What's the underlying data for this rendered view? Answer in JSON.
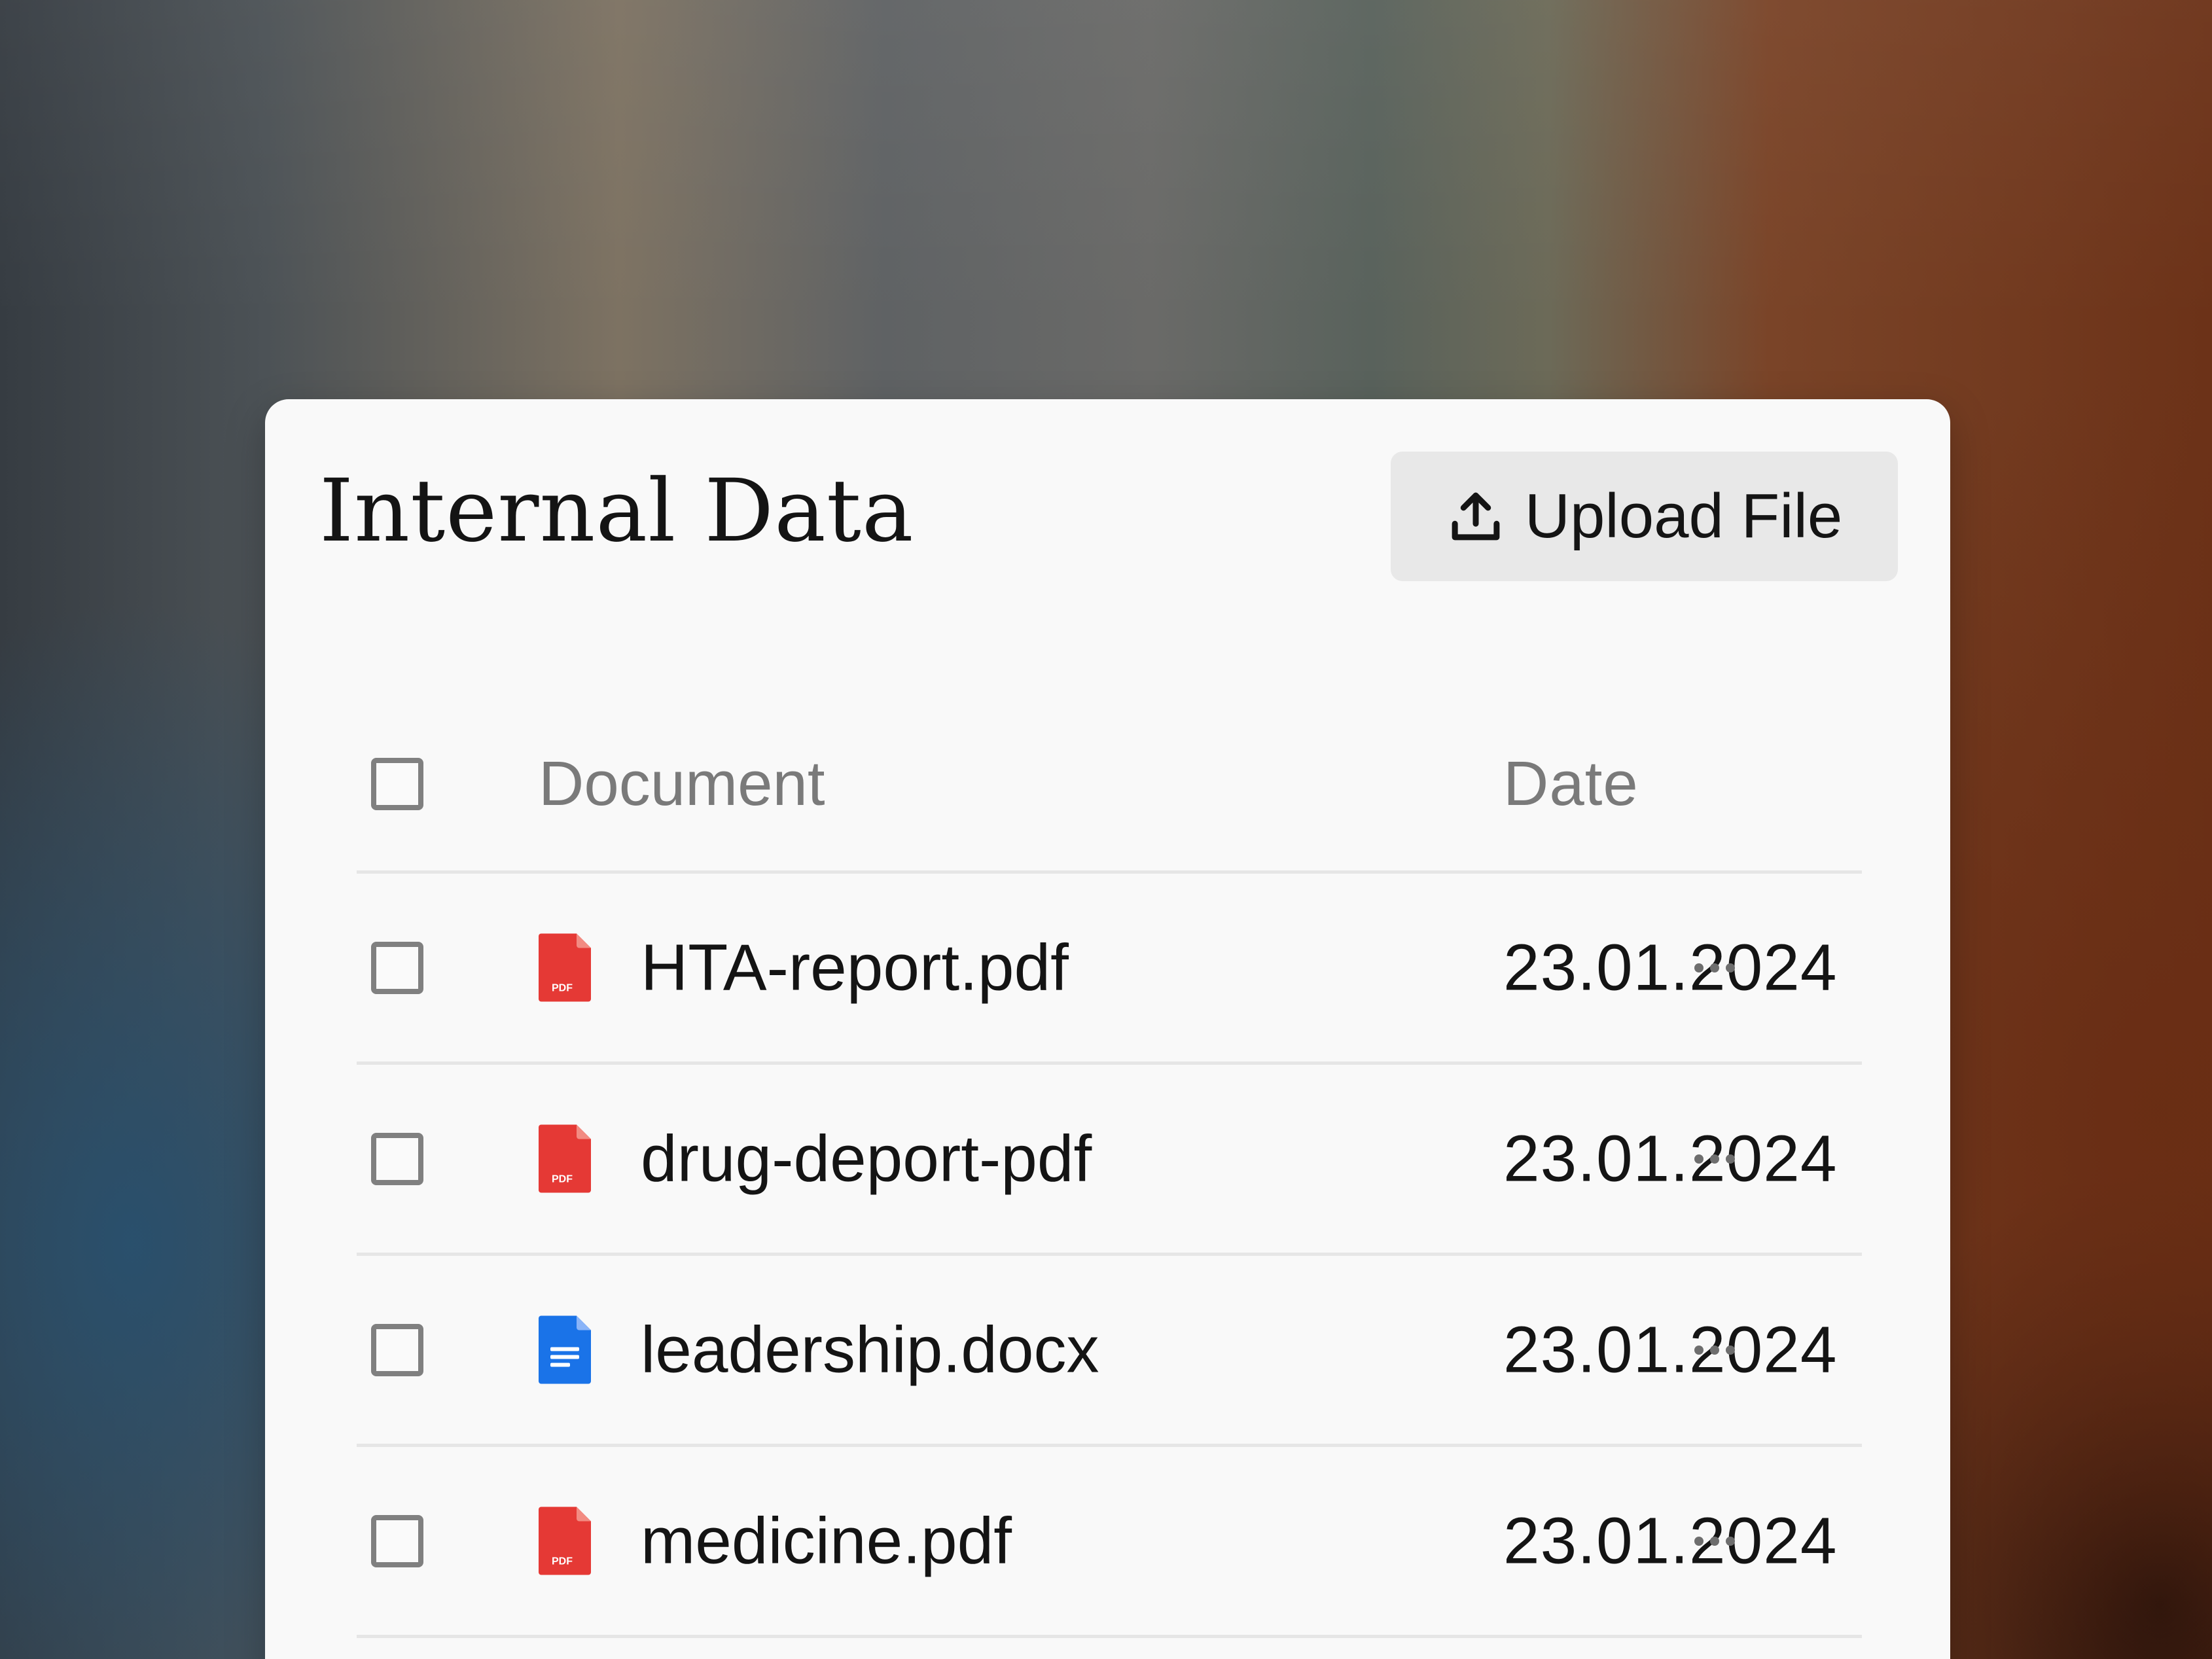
{
  "header": {
    "title": "Internal Data",
    "upload_label": "Upload File",
    "upload_icon": "upload-icon"
  },
  "table": {
    "columns": {
      "document": "Document",
      "date": "Date"
    },
    "rows": [
      {
        "name": "HTA-report.pdf",
        "date": "23.01.2024",
        "type": "pdf",
        "icon": "pdf-file-icon"
      },
      {
        "name": "drug-deport-pdf",
        "date": "23.01.2024",
        "type": "pdf",
        "icon": "pdf-file-icon"
      },
      {
        "name": "leadership.docx",
        "date": "23.01.2024",
        "type": "docx",
        "icon": "doc-file-icon"
      },
      {
        "name": "medicine.pdf",
        "date": "23.01.2024",
        "type": "pdf",
        "icon": "pdf-file-icon"
      }
    ],
    "pdf_badge": "PDF"
  },
  "colors": {
    "pdf": "#e53935",
    "doc": "#1a73e8",
    "panel_bg": "#f9f9f9",
    "button_bg": "#e8e8e8"
  }
}
